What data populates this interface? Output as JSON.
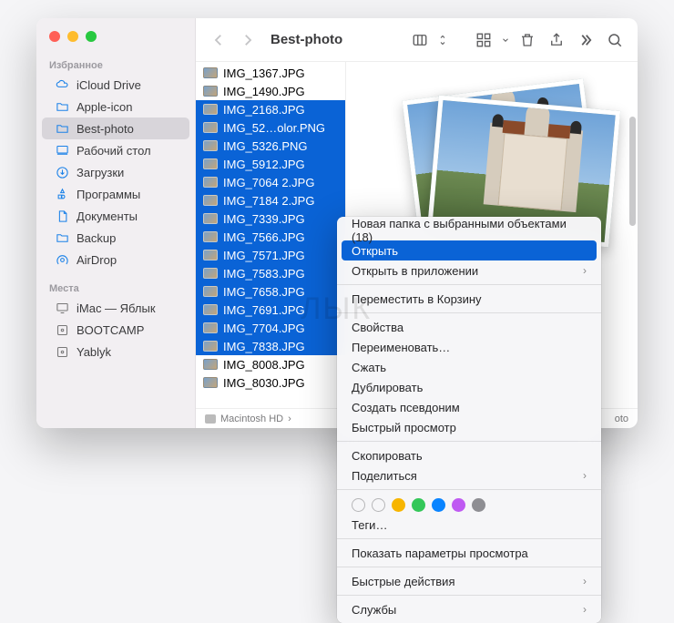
{
  "window": {
    "title": "Best-photo"
  },
  "sidebar": {
    "section_favorites": "Избранное",
    "section_places": "Места",
    "favorites": [
      {
        "label": "iCloud Drive",
        "icon": "cloud"
      },
      {
        "label": "Apple-icon",
        "icon": "folder"
      },
      {
        "label": "Best-photo",
        "icon": "folder",
        "selected": true
      },
      {
        "label": "Рабочий стол",
        "icon": "desktop"
      },
      {
        "label": "Загрузки",
        "icon": "download"
      },
      {
        "label": "Программы",
        "icon": "apps"
      },
      {
        "label": "Документы",
        "icon": "doc"
      },
      {
        "label": "Backup",
        "icon": "folder"
      },
      {
        "label": "AirDrop",
        "icon": "airdrop"
      }
    ],
    "places": [
      {
        "label": "iMac — Яблык",
        "icon": "display"
      },
      {
        "label": "BOOTCAMP",
        "icon": "disk"
      },
      {
        "label": "Yablyk",
        "icon": "disk"
      }
    ]
  },
  "files": [
    {
      "name": "IMG_1367.JPG",
      "selected": false
    },
    {
      "name": "IMG_1490.JPG",
      "selected": false
    },
    {
      "name": "IMG_2168.JPG",
      "selected": true
    },
    {
      "name": "IMG_52…olor.PNG",
      "selected": true
    },
    {
      "name": "IMG_5326.PNG",
      "selected": true
    },
    {
      "name": "IMG_5912.JPG",
      "selected": true
    },
    {
      "name": "IMG_7064 2.JPG",
      "selected": true
    },
    {
      "name": "IMG_7184 2.JPG",
      "selected": true
    },
    {
      "name": "IMG_7339.JPG",
      "selected": true
    },
    {
      "name": "IMG_7566.JPG",
      "selected": true
    },
    {
      "name": "IMG_7571.JPG",
      "selected": true
    },
    {
      "name": "IMG_7583.JPG",
      "selected": true
    },
    {
      "name": "IMG_7658.JPG",
      "selected": true
    },
    {
      "name": "IMG_7691.JPG",
      "selected": true
    },
    {
      "name": "IMG_7704.JPG",
      "selected": true
    },
    {
      "name": "IMG_7838.JPG",
      "selected": true
    },
    {
      "name": "IMG_8008.JPG",
      "selected": false
    },
    {
      "name": "IMG_8030.JPG",
      "selected": false
    }
  ],
  "pathbar": {
    "disk": "Macintosh HD",
    "chev": "›",
    "tail": "oto"
  },
  "context_menu": {
    "items": [
      {
        "label": "Новая папка с выбранными объектами (18)"
      },
      {
        "label": "Открыть",
        "highlighted": true
      },
      {
        "label": "Открыть в приложении",
        "submenu": true
      },
      {
        "sep": true
      },
      {
        "label": "Переместить в Корзину"
      },
      {
        "sep": true
      },
      {
        "label": "Свойства"
      },
      {
        "label": "Переименовать…"
      },
      {
        "label": "Сжать"
      },
      {
        "label": "Дублировать"
      },
      {
        "label": "Создать псевдоним"
      },
      {
        "label": "Быстрый просмотр"
      },
      {
        "sep": true
      },
      {
        "label": "Скопировать"
      },
      {
        "label": "Поделиться",
        "submenu": true
      },
      {
        "sep": true
      },
      {
        "tags": true
      },
      {
        "label": "Теги…"
      },
      {
        "sep": true
      },
      {
        "label": "Показать параметры просмотра"
      },
      {
        "sep": true
      },
      {
        "label": "Быстрые действия",
        "submenu": true
      },
      {
        "sep": true
      },
      {
        "label": "Службы",
        "submenu": true
      }
    ],
    "tag_colors": [
      "",
      "",
      "#f7b500",
      "#34c759",
      "#0a84ff",
      "#bf5af2",
      "#8e8e93"
    ]
  },
  "watermark": "ЛЫК"
}
